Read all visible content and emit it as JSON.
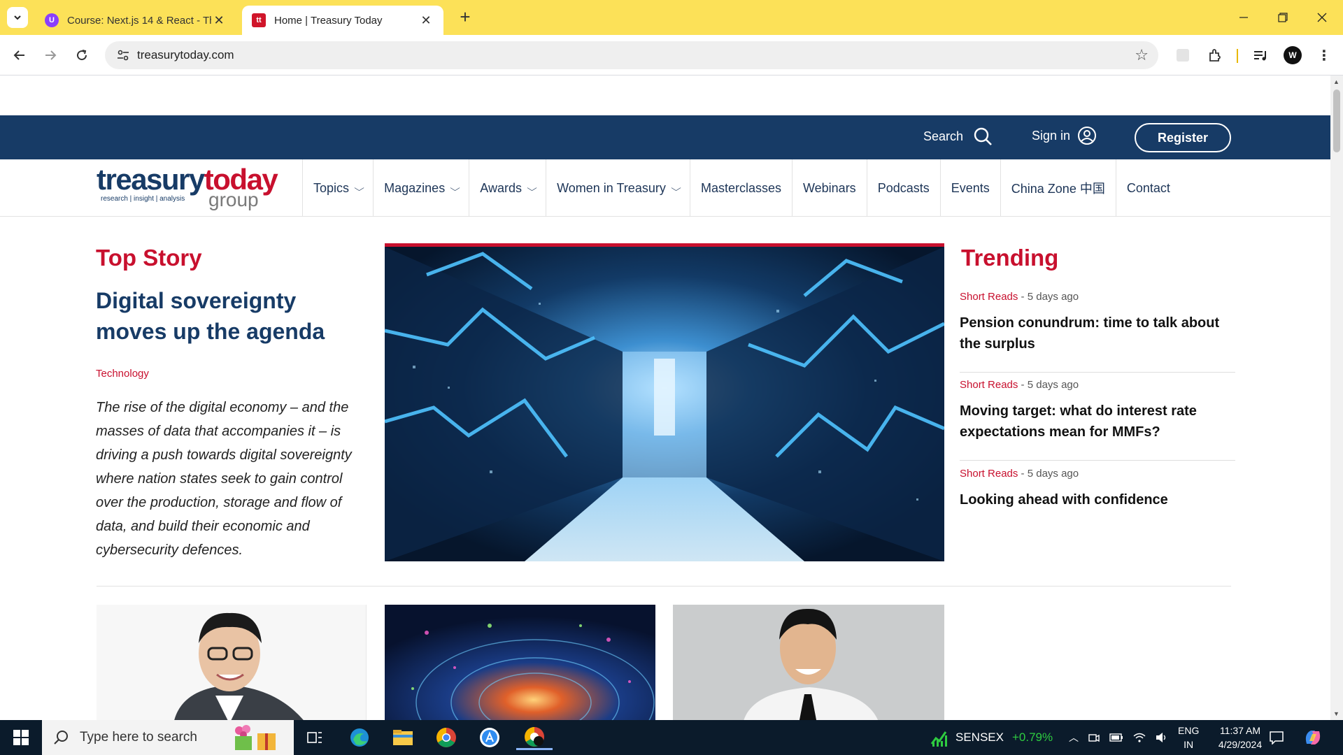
{
  "browser": {
    "tabs": [
      {
        "title": "Course: Next.js 14 & React - The",
        "active": false,
        "favicon_letter": "U"
      },
      {
        "title": "Home | Treasury Today",
        "active": true,
        "favicon_letter": "tt"
      }
    ],
    "url": "treasurytoday.com",
    "profile_initial": "W"
  },
  "site": {
    "topbar": {
      "search_label": "Search",
      "signin_label": "Sign in",
      "register_label": "Register"
    },
    "logo": {
      "word1": "treasury",
      "word2": "today",
      "tagline": "research | insight | analysis",
      "group": "group"
    },
    "nav": [
      {
        "label": "Topics",
        "dropdown": true
      },
      {
        "label": "Magazines",
        "dropdown": true
      },
      {
        "label": "Awards",
        "dropdown": true
      },
      {
        "label": "Women in Treasury",
        "dropdown": true
      },
      {
        "label": "Masterclasses",
        "dropdown": false
      },
      {
        "label": "Webinars",
        "dropdown": false
      },
      {
        "label": "Podcasts",
        "dropdown": false
      },
      {
        "label": "Events",
        "dropdown": false
      },
      {
        "label": "China Zone 中国",
        "dropdown": false
      },
      {
        "label": "Contact",
        "dropdown": false
      }
    ],
    "top_story": {
      "heading": "Top Story",
      "title": "Digital sovereignty moves up the agenda",
      "category": "Technology",
      "description": "The rise of the digital economy – and the masses of data that accompanies it – is driving a push towards digital sovereignty where nation states seek to gain control over the production, storage and flow of data, and build their economic and cybersecurity defences."
    },
    "trending": {
      "heading": "Trending",
      "items": [
        {
          "section": "Short Reads",
          "age": " - 5 days ago",
          "headline": "Pension conundrum: time to talk about the surplus"
        },
        {
          "section": "Short Reads",
          "age": " - 5 days ago",
          "headline": "Moving target: what do interest rate expectations mean for MMFs?"
        },
        {
          "section": "Short Reads",
          "age": " - 5 days ago",
          "headline": "Looking ahead with confidence"
        }
      ]
    }
  },
  "taskbar": {
    "search_placeholder": "Type here to search",
    "ticker_name": "SENSEX",
    "ticker_change": "+0.79%",
    "lang_line1": "ENG",
    "lang_line2": "IN",
    "time": "11:37 AM",
    "date": "4/29/2024"
  },
  "colors": {
    "tabbar": "#fce158",
    "brand_navy": "#173b66",
    "brand_red": "#c8102e",
    "ticker_green": "#2ecc40"
  }
}
